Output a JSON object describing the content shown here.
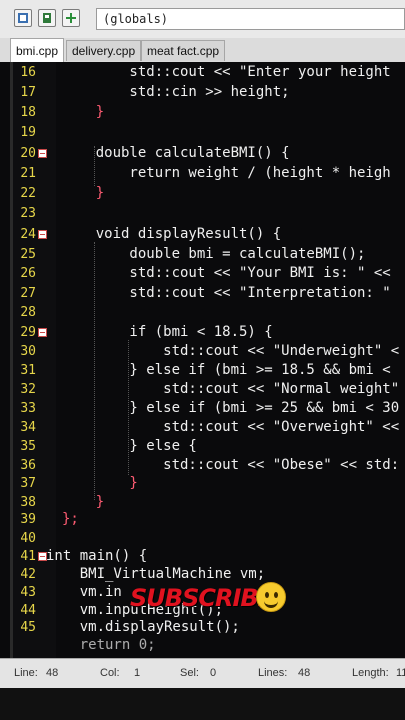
{
  "toolbar": {
    "scope_value": "(globals)"
  },
  "tabs": [
    {
      "label": "bmi.cpp",
      "active": true
    },
    {
      "label": "delivery.cpp",
      "active": false
    },
    {
      "label": "meat fact.cpp",
      "active": false
    }
  ],
  "code_lines": [
    {
      "n": "16",
      "fold": false
    },
    {
      "n": "17",
      "fold": false
    },
    {
      "n": "18",
      "fold": false
    },
    {
      "n": "19",
      "fold": false
    },
    {
      "n": "20",
      "fold": true
    },
    {
      "n": "21",
      "fold": false
    },
    {
      "n": "22",
      "fold": false
    },
    {
      "n": "23",
      "fold": false
    },
    {
      "n": "24",
      "fold": true
    },
    {
      "n": "25",
      "fold": false
    },
    {
      "n": "26",
      "fold": false
    },
    {
      "n": "27",
      "fold": false
    },
    {
      "n": "28",
      "fold": false
    },
    {
      "n": "29",
      "fold": true
    },
    {
      "n": "30",
      "fold": false
    },
    {
      "n": "31",
      "fold": false
    },
    {
      "n": "32",
      "fold": false
    },
    {
      "n": "33",
      "fold": false
    },
    {
      "n": "34",
      "fold": false
    },
    {
      "n": "35",
      "fold": false
    },
    {
      "n": "36",
      "fold": false
    },
    {
      "n": "37",
      "fold": false
    },
    {
      "n": "38",
      "fold": false
    },
    {
      "n": "39",
      "fold": false
    },
    {
      "n": "40",
      "fold": false
    },
    {
      "n": "41",
      "fold": true
    },
    {
      "n": "42",
      "fold": false
    },
    {
      "n": "43",
      "fold": false
    },
    {
      "n": "44",
      "fold": false
    },
    {
      "n": "45",
      "fold": false
    }
  ],
  "code": {
    "l16": "        std::cout << \"Enter your height",
    "l17": "        std::cin >> height;",
    "l18": "    }",
    "l20": "    double calculateBMI() {",
    "l21": "        return weight / (height * heigh",
    "l22": "    }",
    "l24": "    void displayResult() {",
    "l25": "        double bmi = calculateBMI();",
    "l26": "        std::cout << \"Your BMI is: \" <<",
    "l27": "        std::cout << \"Interpretation: \"",
    "l29": "        if (bmi < 18.5) {",
    "l30": "            std::cout << \"Underweight\" <",
    "l31": "        } else if (bmi >= 18.5 && bmi <",
    "l32": "            std::cout << \"Normal weight\"",
    "l33": "        } else if (bmi >= 25 && bmi < 30",
    "l34": "            std::cout << \"Overweight\" <<",
    "l35": "        } else {",
    "l36": "            std::cout << \"Obese\" << std:",
    "l37": "        }",
    "l38": "    }",
    "l39": "};",
    "l41": "int main() {",
    "l42": "    BMI_VirtualMachine vm;",
    "l43": "    vm.in",
    "l44": "    vm.inputHeight();",
    "l45": "    vm.displayResult();",
    "l46": "    return 0;"
  },
  "statusbar": {
    "line_label": "Line:",
    "line_value": "48",
    "col_label": "Col:",
    "col_value": "1",
    "sel_label": "Sel:",
    "sel_value": "0",
    "lines_label": "Lines:",
    "lines_value": "48",
    "length_label": "Length:",
    "length_value": "11"
  },
  "overlay": {
    "subscribe_text": "SUBSCRIBE",
    "emoji": "smiley-face"
  }
}
